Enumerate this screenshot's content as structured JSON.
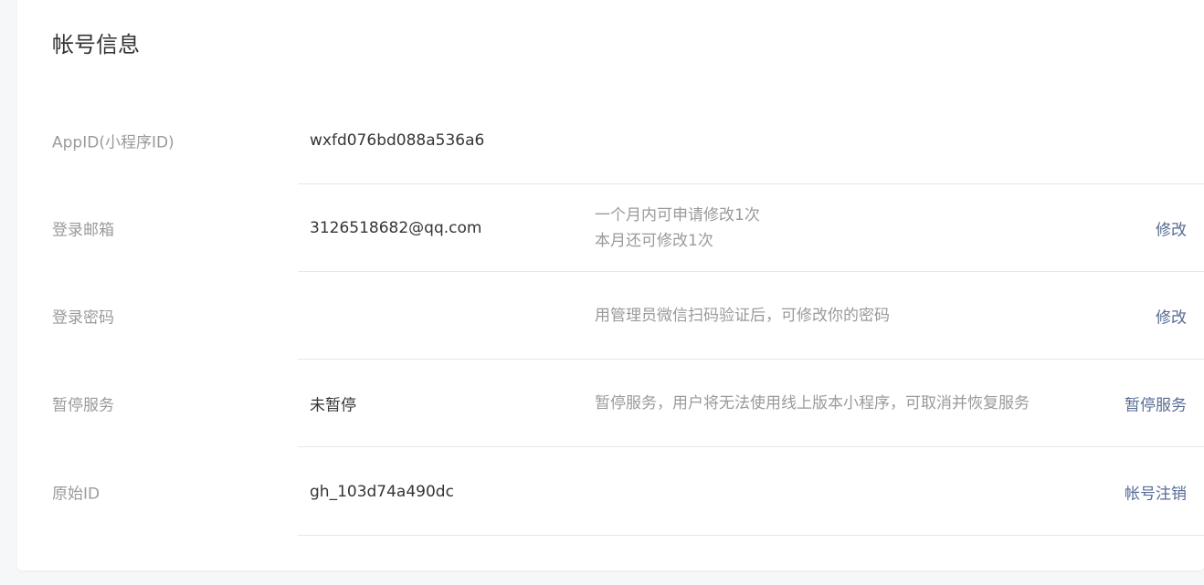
{
  "page_title": "帐号信息",
  "rows": [
    {
      "label": "AppID(小程序ID)",
      "value": "wxfd076bd088a536a6"
    },
    {
      "label": "登录邮箱",
      "value": "3126518682@qq.com",
      "desc_line1": "一个月内可申请修改1次",
      "desc_line2": "本月还可修改1次",
      "action": "修改"
    },
    {
      "label": "登录密码",
      "value": "",
      "desc_line1": "用管理员微信扫码验证后，可修改你的密码",
      "action": "修改"
    },
    {
      "label": "暂停服务",
      "value": "未暂停",
      "desc_line1": "暂停服务，用户将无法使用线上版本小程序，可取消并恢复服务",
      "action": "暂停服务"
    },
    {
      "label": "原始ID",
      "value": "gh_103d74a490dc",
      "action": "帐号注销"
    }
  ],
  "colors": {
    "link": "#576b95",
    "label": "#9a9a9a",
    "value": "#353535",
    "divider": "#e7e7eb"
  }
}
